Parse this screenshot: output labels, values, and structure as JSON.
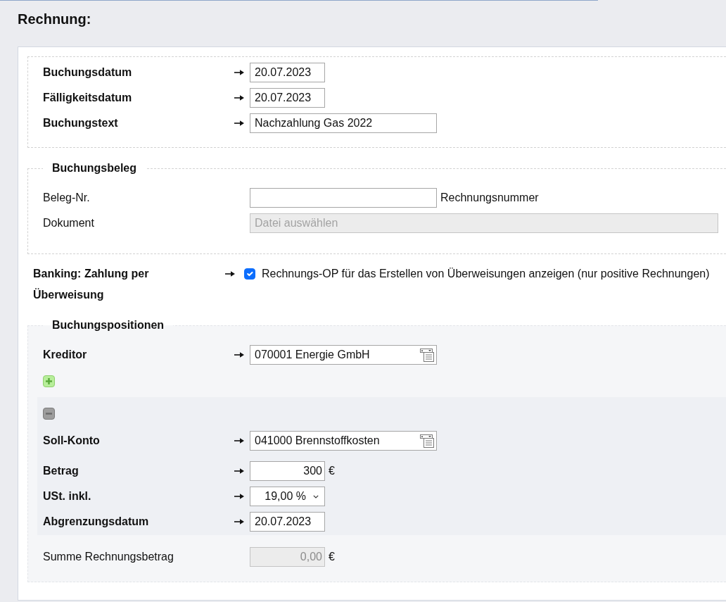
{
  "title": "Rechnung:",
  "general": {
    "rows": [
      {
        "label": "Buchungsdatum",
        "required": true,
        "disabled": false,
        "kind": "date",
        "value": "20.07.2023"
      },
      {
        "label": "Fälligkeitsdatum",
        "required": true,
        "disabled": false,
        "kind": "date",
        "value": "20.07.2023"
      },
      {
        "label": "Buchungstext",
        "required": true,
        "disabled": false,
        "kind": "text",
        "value": "Nachzahlung Gas 2022"
      }
    ]
  },
  "receipt": {
    "legend": "Buchungsbeleg",
    "rows": [
      {
        "label": "Beleg-Nr.",
        "required": false,
        "disabled": false,
        "kind": "text",
        "suffix": "Rechnungsnummer"
      },
      {
        "label": "Dokument",
        "required": false,
        "disabled": true,
        "kind": "file",
        "placeholder": "Datei auswählen"
      }
    ]
  },
  "banking": {
    "label": "Banking: Zahlung per Überweisung",
    "required": true,
    "checked": true,
    "text": "Rechnungs-OP für das Erstellen von Überweisungen anzeigen (nur positive Rechnungen)"
  },
  "positions": {
    "legend": "Buchungspositionen",
    "rows": [
      {
        "label": "Kreditor",
        "required": true,
        "disabled": false,
        "kind": "lookup",
        "value": "070001 Energie GmbH"
      }
    ],
    "items": [
      {
        "rows": [
          {
            "label": "Soll-Konto",
            "required": true,
            "disabled": false,
            "kind": "lookup",
            "value": "041000 Brennstoffkosten"
          },
          {
            "label": "Betrag",
            "required": true,
            "disabled": false,
            "kind": "amount",
            "value": "300",
            "suffix": "€"
          },
          {
            "label": "USt. inkl.",
            "required": true,
            "disabled": false,
            "kind": "select",
            "value": "19,00 %"
          },
          {
            "label": "Abgrenzungsdatum",
            "required": true,
            "disabled": false,
            "kind": "date",
            "value": "20.07.2023"
          }
        ]
      }
    ],
    "total": {
      "label": "Summe Rechnungsbetrag",
      "required": false,
      "disabled": true,
      "kind": "amount",
      "value": "0,00",
      "suffix": "€"
    }
  }
}
